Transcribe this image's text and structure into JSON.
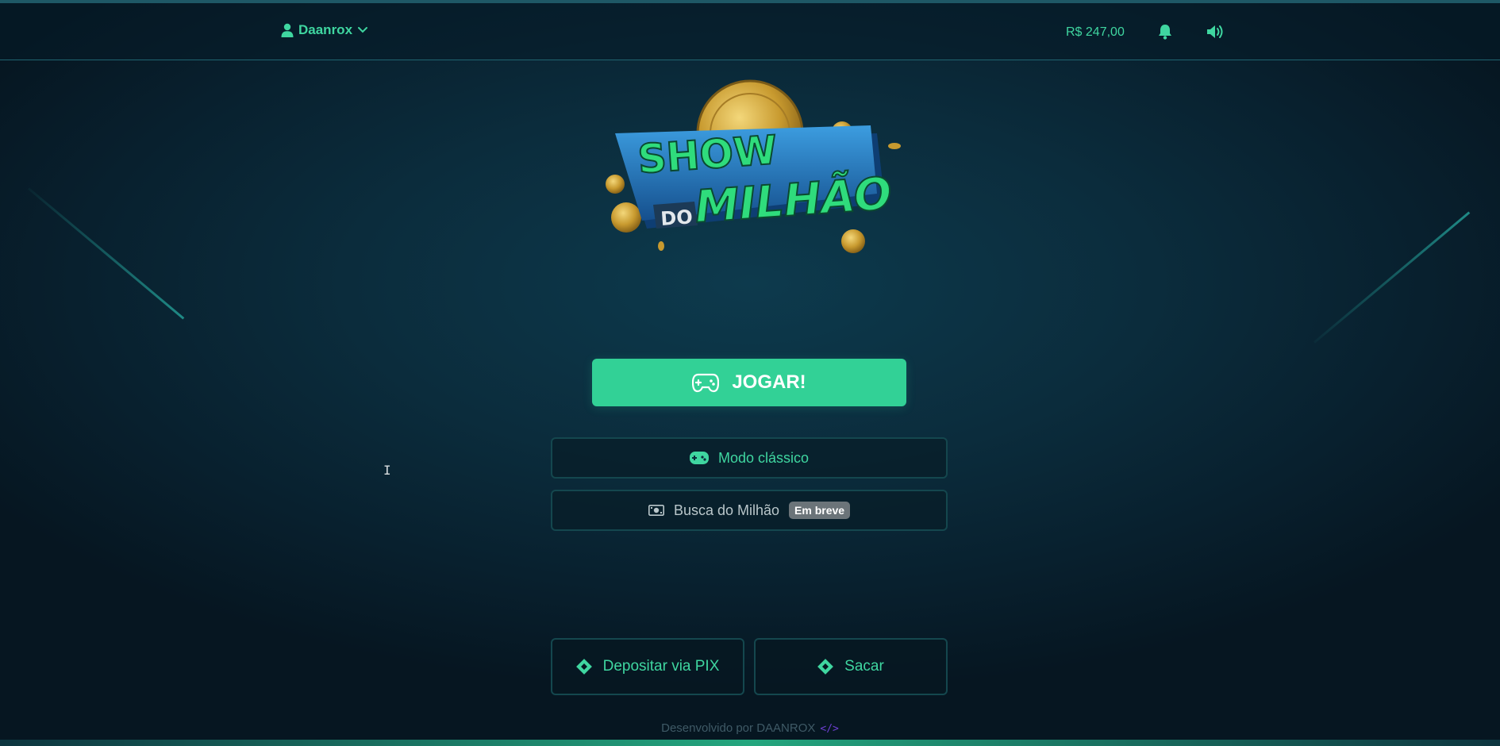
{
  "header": {
    "username": "Daanrox",
    "balance": "R$ 247,00",
    "icons": {
      "user": "user-icon",
      "dropdown": "chevron-down-icon",
      "notifications": "bell-icon",
      "sound": "speaker-icon"
    }
  },
  "logo": {
    "line1": "SHOW",
    "line2_small": "DO",
    "line2_big": "MILHÃO"
  },
  "actions": {
    "play_label": "JOGAR!",
    "classic_label": "Modo clássico",
    "busca_label": "Busca do Milhão",
    "busca_badge": "Em breve",
    "deposit_label": "Depositar via PIX",
    "withdraw_label": "Sacar"
  },
  "footer": {
    "text": "Desenvolvido por DAANROX",
    "code_symbol": "</>"
  },
  "colors": {
    "accent": "#32d196",
    "accent_text": "#3fd6a0",
    "background": "#0b2c3c",
    "badge": "#6b7479",
    "logo_blue": "#1e6fb8",
    "coin_gold": "#d7a93a"
  }
}
